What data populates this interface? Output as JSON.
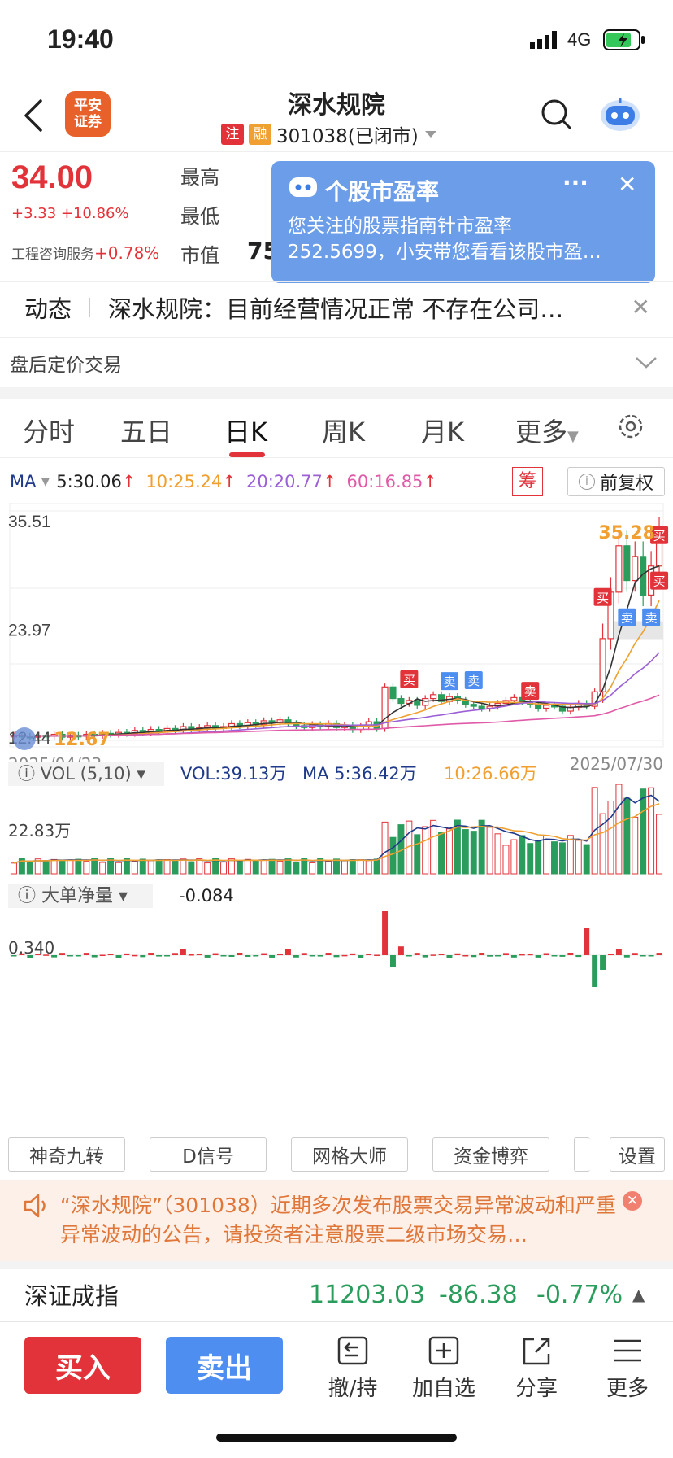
{
  "status_bar": {
    "time": "19:40",
    "network": "4G"
  },
  "header": {
    "logo_text": "平安\n证券",
    "title": "深水规院",
    "tag_zhu": "注",
    "tag_rong": "融",
    "code_status": "301038(已闭市)",
    "colors": {
      "logo": "#e8612a",
      "tag_zhu": "#e2333a",
      "tag_rong": "#f0a030"
    }
  },
  "quote": {
    "price": "34.00",
    "change": "+3.33 +10.86%",
    "industry_label": "工程咨询服务",
    "industry_change": "+0.78%",
    "high_label": "最高",
    "low_label": "最低",
    "mcap_label": "市值",
    "mcap_value_partial": "75"
  },
  "popup": {
    "title": "个股市盈率",
    "body_line1": "您关注的股票指南针市盈率",
    "body_line2": "252.5699，小安带您看看该股市盈…",
    "more": "···",
    "close": "✕"
  },
  "news": {
    "label": "动态",
    "text": "深水规院：目前经营情况正常 不存在公司…",
    "close": "✕"
  },
  "after_hours": {
    "label": "盘后定价交易"
  },
  "tabs": [
    "分时",
    "五日",
    "日K",
    "周K",
    "月K",
    "更多"
  ],
  "ma_bar": {
    "ma_label": "MA",
    "ma5": "5:30.06",
    "ma10": "10:25.24",
    "ma20": "20:20.77",
    "ma60": "60:16.85",
    "chip_btn": "筹",
    "adjust_btn": "前复权"
  },
  "chart_data": [
    {
      "type": "candlestick",
      "title": "",
      "y_axis_labels": [
        "35.51",
        "23.97",
        "12.44"
      ],
      "date_start": "2025/04/23",
      "date_end": "2025/07/30",
      "high_marker": "35.28",
      "low_marker": "12.67",
      "closes": [
        13.0,
        12.9,
        12.8,
        13.0,
        12.9,
        13.1,
        12.8,
        13.0,
        12.9,
        13.1,
        13.0,
        13.2,
        13.1,
        13.3,
        13.2,
        13.5,
        13.3,
        13.6,
        13.4,
        13.7,
        13.5,
        13.9,
        13.6,
        13.8,
        14.0,
        13.7,
        13.9,
        14.2,
        14.0,
        14.3,
        14.1,
        14.5,
        14.3,
        14.6,
        14.2,
        14.0,
        13.8,
        14.1,
        13.9,
        14.2,
        13.8,
        14.0,
        13.6,
        13.9,
        14.4,
        13.7,
        18.0,
        16.8,
        16.3,
        16.6,
        16.1,
        16.8,
        17.2,
        16.5,
        17.0,
        16.6,
        16.2,
        16.0,
        15.8,
        16.0,
        16.3,
        16.6,
        16.9,
        16.5,
        16.2,
        15.8,
        16.1,
        16.0,
        15.5,
        15.9,
        16.3,
        16.0,
        17.5,
        23.0,
        27.8,
        32.6,
        29.0,
        31.5,
        27.5,
        30.5,
        34.0
      ],
      "ma_lines": [
        "MA5",
        "MA10",
        "MA20",
        "MA60"
      ],
      "signal_labels": [
        "买",
        "卖",
        "卖",
        "卖",
        "买",
        "卖",
        "卖",
        "买",
        "买"
      ]
    },
    {
      "type": "bar",
      "title": "VOL (5,10)",
      "summary": "VOL:39.13万",
      "ma5": "MA 5:36.42万",
      "ma10": "10:26.66万",
      "y_axis_label": "22.83万"
    },
    {
      "type": "bar",
      "title": "大单净量",
      "value": "-0.084",
      "y_axis_label": "0.340"
    }
  ],
  "tools": [
    "神奇九转",
    "D信号",
    "网格大师",
    "资金博弈",
    "设置"
  ],
  "notice": {
    "text": "“深水规院”（301038）近期多次发布股票交易异常波动和严重异常波动的公告，请投资者注意股票二级市场交易…"
  },
  "index": {
    "name": "深证成指",
    "value": "11203.03",
    "change": "-86.38",
    "pct": "-0.77%"
  },
  "bottom_bar": {
    "buy": "买入",
    "sell": "卖出",
    "nav": [
      "撤/持",
      "加自选",
      "分享",
      "更多"
    ]
  }
}
